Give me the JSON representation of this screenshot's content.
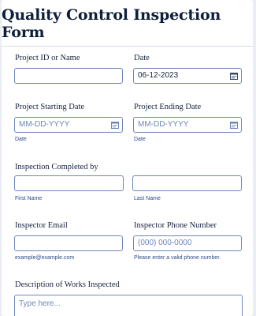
{
  "form": {
    "title": "Quality Control Inspection Form"
  },
  "fields": {
    "project_id": {
      "label": "Project ID or Name",
      "value": ""
    },
    "date": {
      "label": "Date",
      "value": "06-12-2023",
      "icon": "calendar-icon"
    },
    "start_date": {
      "label": "Project Starting Date",
      "placeholder": "MM-DD-YYYY",
      "sublabel": "Date",
      "icon": "calendar-icon"
    },
    "end_date": {
      "label": "Project Ending Date",
      "placeholder": "MM-DD-YYYY",
      "sublabel": "Date",
      "icon": "calendar-icon"
    },
    "inspector": {
      "label": "Inspection Completed by",
      "first_sublabel": "First Name",
      "last_sublabel": "Last Name"
    },
    "email": {
      "label": "Inspector Email",
      "sublabel": "example@example.com"
    },
    "phone": {
      "label": "Inspector Phone Number",
      "placeholder": "(000) 000-0000",
      "sublabel": "Please enter a valid phone number."
    },
    "description": {
      "label": "Description of Works Inspected",
      "placeholder": "Type here..."
    }
  },
  "colors": {
    "accent": "#6f86bb",
    "title": "#0f1f3a",
    "sublabel": "#2d4a8a"
  }
}
